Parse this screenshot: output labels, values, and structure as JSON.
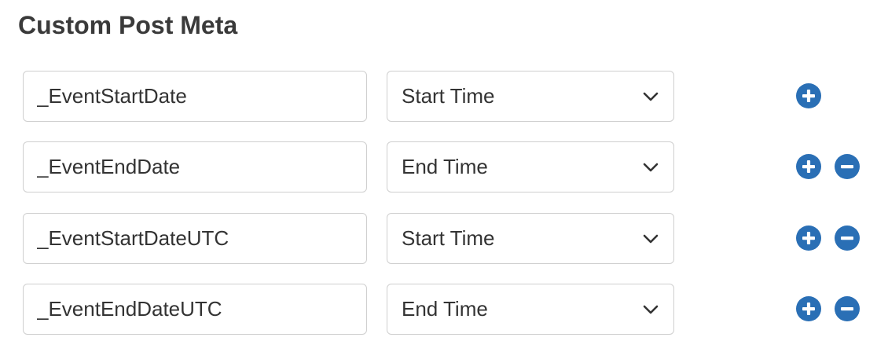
{
  "section": {
    "title": "Custom Post Meta"
  },
  "rows": [
    {
      "key": "_EventStartDate",
      "field": "Start Time",
      "can_remove": false
    },
    {
      "key": "_EventEndDate",
      "field": "End Time",
      "can_remove": true
    },
    {
      "key": "_EventStartDateUTC",
      "field": "Start Time",
      "can_remove": true
    },
    {
      "key": "_EventEndDateUTC",
      "field": "End Time",
      "can_remove": true
    }
  ],
  "icons": {
    "add": "plus-circle-icon",
    "remove": "minus-circle-icon",
    "dropdown": "chevron-down-icon"
  },
  "colors": {
    "accent": "#2a6fb5",
    "border": "#cfcfcf",
    "text": "#333333"
  }
}
